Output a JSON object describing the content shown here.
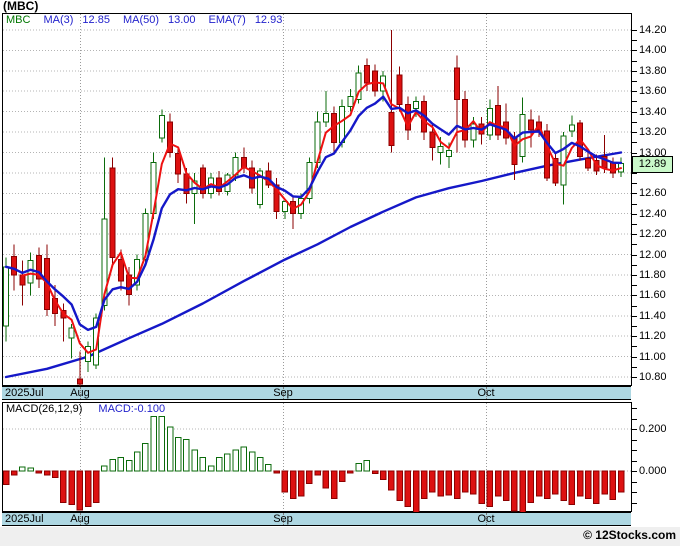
{
  "title": "(MBC)",
  "watermark": "© 12Stocks.com",
  "colors": {
    "candle_up_stroke": "#0b6b0b",
    "candle_up_fill": "#ffffff",
    "candle_down_stroke": "#8b0000",
    "candle_down_fill": "#dd1111",
    "line_blue": "#1518c8",
    "line_red": "#ee1111",
    "grid": "#b4b4b4",
    "month_grid": "#9a9a9a",
    "axis_bar_bg": "#aed7e2",
    "highlight_bg": "#c9f8c9",
    "legend_blue": "#2222cc",
    "legend_green": "#007700"
  },
  "months": [
    {
      "label": "2025Jul",
      "x": 3,
      "align": "left",
      "gridline": false
    },
    {
      "label": "Aug",
      "x": 80,
      "align": "center",
      "gridline": true
    },
    {
      "label": "Sep",
      "x": 283,
      "align": "center",
      "gridline": true
    },
    {
      "label": "Oct",
      "x": 486,
      "align": "center",
      "gridline": true
    }
  ],
  "main_chart": {
    "legend": {
      "symbol": "MBC",
      "items": [
        {
          "label": "MA(3)",
          "value": "12.85"
        },
        {
          "label": "MA(50)",
          "value": "13.00"
        },
        {
          "label": "EMA(7)",
          "value": "12.93"
        }
      ]
    },
    "axis": {
      "y_max": 14.2,
      "y_min": 10.8,
      "label_step": 0.2,
      "tick_step": 0.1,
      "hidden_label": 12.8,
      "current_price": "12.89"
    }
  },
  "macd_panel": {
    "legend": {
      "name": "MACD(26,12,9)",
      "value": "MACD:-0.100"
    },
    "axis": {
      "y_labels": [
        0.2,
        0.0
      ],
      "tick_step": 0.05,
      "tick_top": 0.3,
      "tick_bottom": -0.15
    }
  },
  "chart_data": [
    {
      "type": "candlestick",
      "name": "MBC daily price, Jul-Oct 2025",
      "ylim": [
        10.8,
        14.2
      ],
      "grid": true,
      "last_close": 12.89,
      "candles_ohlc": [
        [
          11.3,
          11.97,
          11.15,
          11.88
        ],
        [
          11.98,
          12.1,
          11.65,
          11.8
        ],
        [
          11.8,
          11.94,
          11.5,
          11.7
        ],
        [
          11.72,
          12.02,
          11.6,
          11.94
        ],
        [
          11.99,
          12.07,
          11.67,
          11.76
        ],
        [
          11.96,
          12.1,
          11.4,
          11.46
        ],
        [
          11.57,
          11.7,
          11.3,
          11.42
        ],
        [
          11.45,
          11.52,
          11.15,
          11.38
        ],
        [
          11.18,
          11.32,
          10.98,
          11.28
        ],
        [
          10.78,
          11.05,
          10.6,
          10.73
        ],
        [
          10.95,
          11.15,
          10.85,
          11.1
        ],
        [
          10.92,
          11.42,
          10.88,
          11.38
        ],
        [
          11.5,
          12.95,
          11.45,
          12.35
        ],
        [
          12.85,
          12.95,
          11.9,
          11.97
        ],
        [
          11.95,
          12.05,
          11.65,
          11.74
        ],
        [
          11.8,
          11.88,
          11.5,
          11.61
        ],
        [
          11.7,
          12.0,
          11.65,
          11.95
        ],
        [
          11.95,
          12.45,
          11.9,
          12.4
        ],
        [
          12.4,
          13.0,
          12.35,
          12.9
        ],
        [
          13.14,
          13.42,
          13.1,
          13.36
        ],
        [
          13.3,
          13.38,
          12.95,
          13.0
        ],
        [
          12.99,
          13.05,
          12.7,
          12.79
        ],
        [
          12.79,
          12.85,
          12.5,
          12.6
        ],
        [
          12.6,
          12.8,
          12.3,
          12.72
        ],
        [
          12.85,
          12.88,
          12.55,
          12.6
        ],
        [
          12.6,
          12.8,
          12.55,
          12.75
        ],
        [
          12.75,
          12.82,
          12.58,
          12.62
        ],
        [
          12.62,
          12.8,
          12.58,
          12.78
        ],
        [
          12.78,
          13.0,
          12.72,
          12.95
        ],
        [
          12.95,
          13.05,
          12.8,
          12.85
        ],
        [
          12.85,
          12.92,
          12.6,
          12.65
        ],
        [
          12.49,
          12.85,
          12.45,
          12.82
        ],
        [
          12.82,
          12.9,
          12.65,
          12.68
        ],
        [
          12.68,
          12.75,
          12.35,
          12.42
        ],
        [
          12.42,
          12.55,
          12.35,
          12.52
        ],
        [
          12.52,
          12.58,
          12.25,
          12.4
        ],
        [
          12.4,
          12.6,
          12.35,
          12.55
        ],
        [
          12.55,
          12.95,
          12.5,
          12.9
        ],
        [
          12.9,
          13.4,
          12.85,
          13.3
        ],
        [
          13.3,
          13.6,
          13.25,
          13.38
        ],
        [
          13.38,
          13.45,
          13.0,
          13.1
        ],
        [
          13.1,
          13.52,
          13.05,
          13.45
        ],
        [
          13.45,
          13.62,
          13.4,
          13.55
        ],
        [
          13.52,
          13.85,
          13.48,
          13.78
        ],
        [
          13.85,
          13.92,
          13.6,
          13.68
        ],
        [
          13.8,
          13.86,
          13.55,
          13.6
        ],
        [
          13.6,
          13.8,
          13.5,
          13.75
        ],
        [
          13.39,
          14.2,
          13.0,
          13.07
        ],
        [
          13.76,
          13.84,
          13.4,
          13.47
        ],
        [
          13.47,
          13.55,
          13.12,
          13.22
        ],
        [
          13.43,
          13.55,
          13.35,
          13.5
        ],
        [
          13.5,
          13.56,
          13.12,
          13.2
        ],
        [
          13.2,
          13.28,
          12.92,
          13.05
        ],
        [
          13.0,
          13.15,
          12.88,
          13.06
        ],
        [
          12.96,
          13.1,
          12.85,
          13.02
        ],
        [
          13.83,
          13.95,
          13.0,
          13.52
        ],
        [
          13.52,
          13.6,
          13.05,
          13.12
        ],
        [
          13.12,
          13.35,
          13.05,
          13.28
        ],
        [
          13.28,
          13.35,
          13.08,
          13.18
        ],
        [
          13.17,
          13.52,
          13.12,
          13.43
        ],
        [
          13.46,
          13.65,
          13.12,
          13.17
        ],
        [
          13.3,
          13.48,
          13.08,
          13.14
        ],
        [
          13.14,
          13.2,
          12.73,
          12.88
        ],
        [
          12.96,
          13.54,
          12.9,
          13.37
        ],
        [
          13.32,
          13.42,
          13.05,
          13.22
        ],
        [
          13.3,
          13.36,
          13.15,
          13.22
        ],
        [
          13.21,
          13.28,
          12.72,
          12.75
        ],
        [
          12.94,
          13.0,
          12.67,
          12.7
        ],
        [
          12.68,
          13.2,
          12.49,
          13.16
        ],
        [
          13.21,
          13.36,
          13.15,
          13.27
        ],
        [
          13.29,
          13.32,
          12.92,
          12.96
        ],
        [
          12.94,
          13.0,
          12.82,
          12.85
        ],
        [
          12.92,
          12.98,
          12.78,
          12.82
        ],
        [
          12.96,
          13.17,
          12.8,
          12.85
        ],
        [
          12.9,
          12.95,
          12.75,
          12.8
        ],
        [
          12.81,
          12.95,
          12.76,
          12.89
        ]
      ],
      "overlays": {
        "ma_periods": {
          "ma3": 3,
          "ema7": 7,
          "ma50": 50
        },
        "ma50_points": [
          [
            0,
            10.8
          ],
          [
            5,
            10.88
          ],
          [
            10,
            11.0
          ],
          [
            15,
            11.18
          ],
          [
            19,
            11.32
          ],
          [
            24,
            11.52
          ],
          [
            29,
            11.74
          ],
          [
            34,
            11.95
          ],
          [
            38,
            12.1
          ],
          [
            42,
            12.27
          ],
          [
            46,
            12.42
          ],
          [
            50,
            12.56
          ],
          [
            54,
            12.65
          ],
          [
            58,
            12.72
          ],
          [
            62,
            12.8
          ],
          [
            66,
            12.87
          ],
          [
            70,
            12.93
          ],
          [
            75,
            13.0
          ]
        ]
      }
    },
    {
      "type": "bar",
      "name": "MACD(26,12,9)",
      "ylim": [
        -0.2,
        0.3
      ],
      "last_value": -0.1,
      "values": [
        -0.065,
        -0.02,
        0.02,
        0.015,
        -0.01,
        -0.02,
        -0.03,
        -0.15,
        -0.16,
        -0.185,
        -0.17,
        -0.15,
        0.025,
        0.055,
        0.065,
        0.05,
        0.09,
        0.13,
        0.26,
        0.26,
        0.21,
        0.16,
        0.15,
        0.1,
        0.065,
        0.025,
        0.065,
        0.08,
        0.1,
        0.115,
        0.09,
        0.065,
        0.03,
        -0.01,
        -0.1,
        -0.13,
        -0.12,
        -0.06,
        -0.02,
        -0.08,
        -0.13,
        -0.05,
        -0.01,
        0.035,
        0.05,
        -0.012,
        -0.04,
        -0.09,
        -0.14,
        -0.17,
        -0.2,
        -0.13,
        -0.1,
        -0.12,
        -0.115,
        -0.13,
        -0.1,
        -0.11,
        -0.155,
        -0.17,
        -0.12,
        -0.14,
        -0.19,
        -0.21,
        -0.15,
        -0.12,
        -0.13,
        -0.11,
        -0.14,
        -0.16,
        -0.12,
        -0.13,
        -0.155,
        -0.11,
        -0.135,
        -0.1
      ]
    }
  ]
}
